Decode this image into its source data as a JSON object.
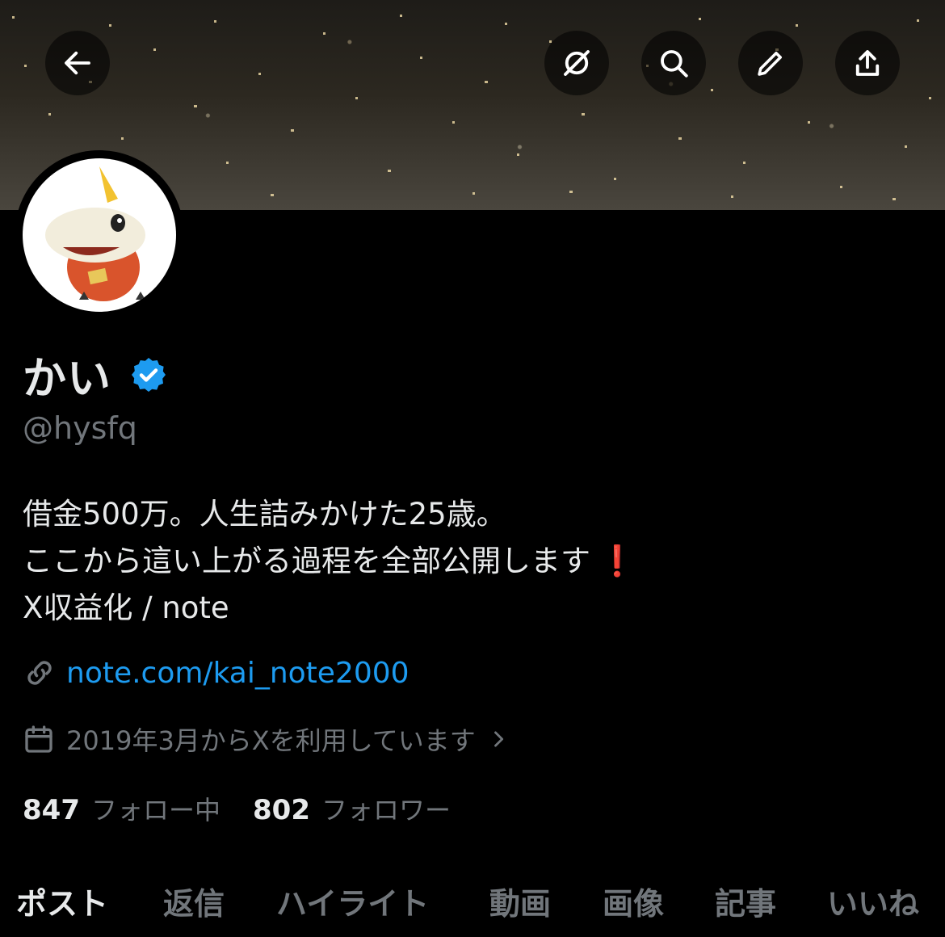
{
  "header": {
    "back_icon": "arrow-left-icon",
    "grok_icon": "grok-slash-icon",
    "search_icon": "search-icon",
    "edit_icon": "pencil-icon",
    "share_icon": "share-upload-icon"
  },
  "profile": {
    "display_name": "かい",
    "verified_icon": "verified-badge-icon",
    "handle": "@hysfq",
    "bio_lines": [
      "借金500万。人生詰みかけた25歳。",
      "ここから這い上がる過程を全部公開します",
      "X収益化 / note"
    ],
    "bio_emoji": "❗",
    "link": "note.com/kai_note2000",
    "joined": "2019年3月からXを利用しています",
    "following_count": "847",
    "following_label": "フォロー中",
    "followers_count": "802",
    "followers_label": "フォロワー"
  },
  "tabs": [
    {
      "label": "ポスト",
      "active": true
    },
    {
      "label": "返信",
      "active": false
    },
    {
      "label": "ハイライト",
      "active": false
    },
    {
      "label": "動画",
      "active": false
    },
    {
      "label": "画像",
      "active": false
    },
    {
      "label": "記事",
      "active": false
    },
    {
      "label": "いいね",
      "active": false
    }
  ],
  "colors": {
    "background": "#000000",
    "text_primary": "#e7e9ea",
    "text_secondary": "#71767b",
    "link": "#1d9bf0",
    "verified": "#1d9bf0",
    "exclaim": "#e0245e"
  }
}
